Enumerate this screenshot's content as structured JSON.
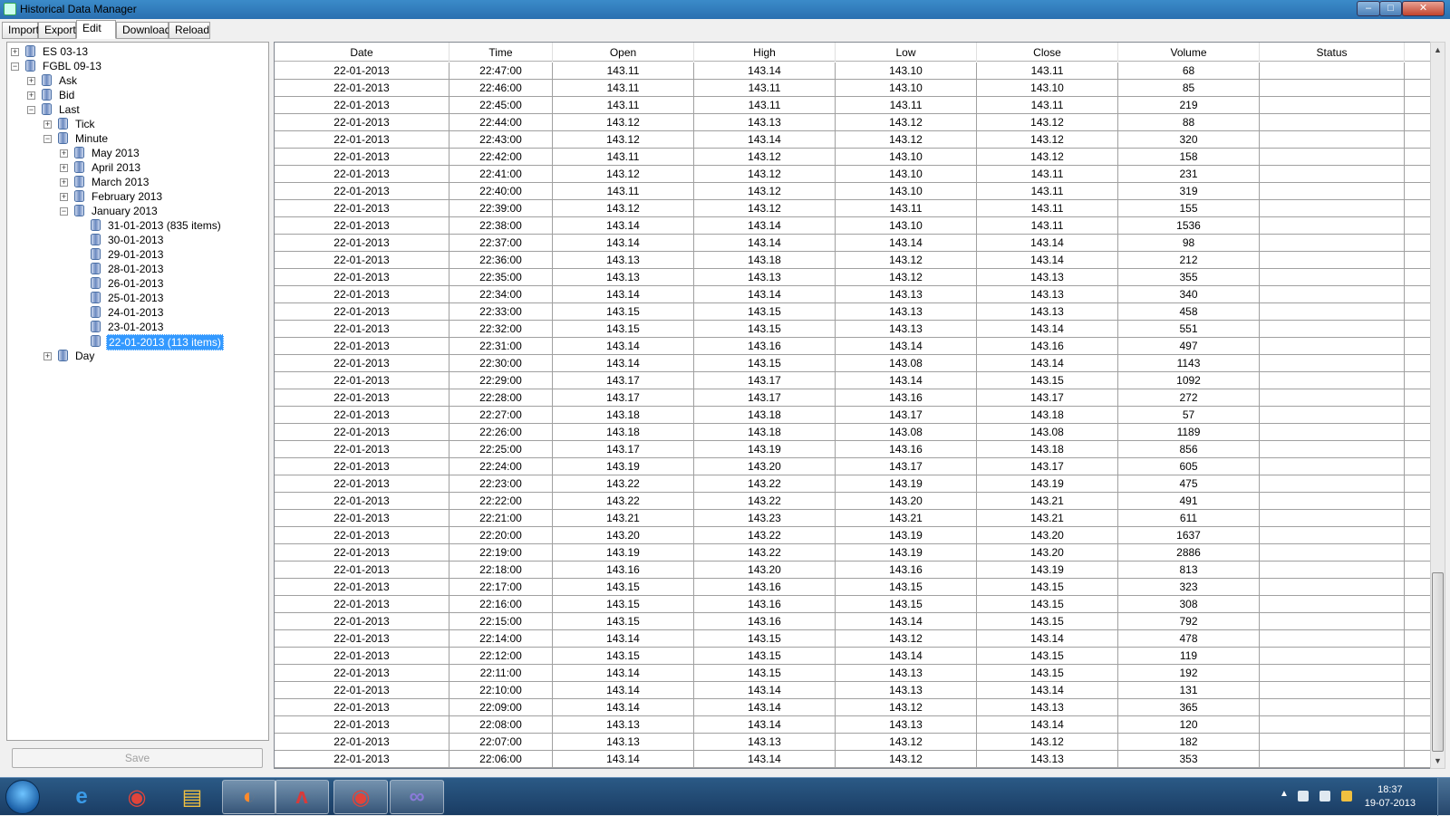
{
  "window": {
    "title": "Historical Data Manager",
    "minimize": "‒",
    "maximize": "□",
    "close": "✕"
  },
  "menu": {
    "tabs": [
      "Import",
      "Export",
      "Edit",
      "Download",
      "Reload"
    ],
    "active": "Edit"
  },
  "tree": {
    "nodes": [
      {
        "label": "ES 03-13",
        "level": 0,
        "expander": "+"
      },
      {
        "label": "FGBL 09-13",
        "level": 0,
        "expander": "−"
      },
      {
        "label": "Ask",
        "level": 1,
        "expander": "+"
      },
      {
        "label": "Bid",
        "level": 1,
        "expander": "+"
      },
      {
        "label": "Last",
        "level": 1,
        "expander": "−"
      },
      {
        "label": "Tick",
        "level": 2,
        "expander": "+"
      },
      {
        "label": "Minute",
        "level": 2,
        "expander": "−"
      },
      {
        "label": "May 2013",
        "level": 3,
        "expander": "+"
      },
      {
        "label": "April 2013",
        "level": 3,
        "expander": "+"
      },
      {
        "label": "March 2013",
        "level": 3,
        "expander": "+"
      },
      {
        "label": "February 2013",
        "level": 3,
        "expander": "+"
      },
      {
        "label": "January 2013",
        "level": 3,
        "expander": "−"
      },
      {
        "label": "31-01-2013 (835 items)",
        "level": 4,
        "expander": ""
      },
      {
        "label": "30-01-2013",
        "level": 4,
        "expander": ""
      },
      {
        "label": "29-01-2013",
        "level": 4,
        "expander": ""
      },
      {
        "label": "28-01-2013",
        "level": 4,
        "expander": ""
      },
      {
        "label": "26-01-2013",
        "level": 4,
        "expander": ""
      },
      {
        "label": "25-01-2013",
        "level": 4,
        "expander": ""
      },
      {
        "label": "24-01-2013",
        "level": 4,
        "expander": ""
      },
      {
        "label": "23-01-2013",
        "level": 4,
        "expander": ""
      },
      {
        "label": "22-01-2013 (113 items)",
        "level": 4,
        "expander": "",
        "selected": true
      },
      {
        "label": "Day",
        "level": 2,
        "expander": "+"
      }
    ],
    "save_label": "Save"
  },
  "grid": {
    "columns": [
      "Date",
      "Time",
      "Open",
      "High",
      "Low",
      "Close",
      "Volume",
      "Status"
    ],
    "rows": [
      [
        "22-01-2013",
        "22:47:00",
        "143.11",
        "143.14",
        "143.10",
        "143.11",
        "68",
        ""
      ],
      [
        "22-01-2013",
        "22:46:00",
        "143.11",
        "143.11",
        "143.10",
        "143.10",
        "85",
        ""
      ],
      [
        "22-01-2013",
        "22:45:00",
        "143.11",
        "143.11",
        "143.11",
        "143.11",
        "219",
        ""
      ],
      [
        "22-01-2013",
        "22:44:00",
        "143.12",
        "143.13",
        "143.12",
        "143.12",
        "88",
        ""
      ],
      [
        "22-01-2013",
        "22:43:00",
        "143.12",
        "143.14",
        "143.12",
        "143.12",
        "320",
        ""
      ],
      [
        "22-01-2013",
        "22:42:00",
        "143.11",
        "143.12",
        "143.10",
        "143.12",
        "158",
        ""
      ],
      [
        "22-01-2013",
        "22:41:00",
        "143.12",
        "143.12",
        "143.10",
        "143.11",
        "231",
        ""
      ],
      [
        "22-01-2013",
        "22:40:00",
        "143.11",
        "143.12",
        "143.10",
        "143.11",
        "319",
        ""
      ],
      [
        "22-01-2013",
        "22:39:00",
        "143.12",
        "143.12",
        "143.11",
        "143.11",
        "155",
        ""
      ],
      [
        "22-01-2013",
        "22:38:00",
        "143.14",
        "143.14",
        "143.10",
        "143.11",
        "1536",
        ""
      ],
      [
        "22-01-2013",
        "22:37:00",
        "143.14",
        "143.14",
        "143.14",
        "143.14",
        "98",
        ""
      ],
      [
        "22-01-2013",
        "22:36:00",
        "143.13",
        "143.18",
        "143.12",
        "143.14",
        "212",
        ""
      ],
      [
        "22-01-2013",
        "22:35:00",
        "143.13",
        "143.13",
        "143.12",
        "143.13",
        "355",
        ""
      ],
      [
        "22-01-2013",
        "22:34:00",
        "143.14",
        "143.14",
        "143.13",
        "143.13",
        "340",
        ""
      ],
      [
        "22-01-2013",
        "22:33:00",
        "143.15",
        "143.15",
        "143.13",
        "143.13",
        "458",
        ""
      ],
      [
        "22-01-2013",
        "22:32:00",
        "143.15",
        "143.15",
        "143.13",
        "143.14",
        "551",
        ""
      ],
      [
        "22-01-2013",
        "22:31:00",
        "143.14",
        "143.16",
        "143.14",
        "143.16",
        "497",
        ""
      ],
      [
        "22-01-2013",
        "22:30:00",
        "143.14",
        "143.15",
        "143.08",
        "143.14",
        "1143",
        ""
      ],
      [
        "22-01-2013",
        "22:29:00",
        "143.17",
        "143.17",
        "143.14",
        "143.15",
        "1092",
        ""
      ],
      [
        "22-01-2013",
        "22:28:00",
        "143.17",
        "143.17",
        "143.16",
        "143.17",
        "272",
        ""
      ],
      [
        "22-01-2013",
        "22:27:00",
        "143.18",
        "143.18",
        "143.17",
        "143.18",
        "57",
        ""
      ],
      [
        "22-01-2013",
        "22:26:00",
        "143.18",
        "143.18",
        "143.08",
        "143.08",
        "1189",
        ""
      ],
      [
        "22-01-2013",
        "22:25:00",
        "143.17",
        "143.19",
        "143.16",
        "143.18",
        "856",
        ""
      ],
      [
        "22-01-2013",
        "22:24:00",
        "143.19",
        "143.20",
        "143.17",
        "143.17",
        "605",
        ""
      ],
      [
        "22-01-2013",
        "22:23:00",
        "143.22",
        "143.22",
        "143.19",
        "143.19",
        "475",
        ""
      ],
      [
        "22-01-2013",
        "22:22:00",
        "143.22",
        "143.22",
        "143.20",
        "143.21",
        "491",
        ""
      ],
      [
        "22-01-2013",
        "22:21:00",
        "143.21",
        "143.23",
        "143.21",
        "143.21",
        "611",
        ""
      ],
      [
        "22-01-2013",
        "22:20:00",
        "143.20",
        "143.22",
        "143.19",
        "143.20",
        "1637",
        ""
      ],
      [
        "22-01-2013",
        "22:19:00",
        "143.19",
        "143.22",
        "143.19",
        "143.20",
        "2886",
        ""
      ],
      [
        "22-01-2013",
        "22:18:00",
        "143.16",
        "143.20",
        "143.16",
        "143.19",
        "813",
        ""
      ],
      [
        "22-01-2013",
        "22:17:00",
        "143.15",
        "143.16",
        "143.15",
        "143.15",
        "323",
        ""
      ],
      [
        "22-01-2013",
        "22:16:00",
        "143.15",
        "143.16",
        "143.15",
        "143.15",
        "308",
        ""
      ],
      [
        "22-01-2013",
        "22:15:00",
        "143.15",
        "143.16",
        "143.14",
        "143.15",
        "792",
        ""
      ],
      [
        "22-01-2013",
        "22:14:00",
        "143.14",
        "143.15",
        "143.12",
        "143.14",
        "478",
        ""
      ],
      [
        "22-01-2013",
        "22:12:00",
        "143.15",
        "143.15",
        "143.14",
        "143.15",
        "119",
        ""
      ],
      [
        "22-01-2013",
        "22:11:00",
        "143.14",
        "143.15",
        "143.13",
        "143.15",
        "192",
        ""
      ],
      [
        "22-01-2013",
        "22:10:00",
        "143.14",
        "143.14",
        "143.13",
        "143.14",
        "131",
        ""
      ],
      [
        "22-01-2013",
        "22:09:00",
        "143.14",
        "143.14",
        "143.12",
        "143.13",
        "365",
        ""
      ],
      [
        "22-01-2013",
        "22:08:00",
        "143.13",
        "143.14",
        "143.13",
        "143.14",
        "120",
        ""
      ],
      [
        "22-01-2013",
        "22:07:00",
        "143.13",
        "143.13",
        "143.12",
        "143.12",
        "182",
        ""
      ],
      [
        "22-01-2013",
        "22:06:00",
        "143.14",
        "143.14",
        "143.12",
        "143.13",
        "353",
        ""
      ]
    ]
  },
  "scrollbar": {
    "up": "▲",
    "down": "▼",
    "position_fraction": 0.75
  },
  "taskbar": {
    "items": [
      {
        "name": "start-button",
        "icon": "windows-orb-icon"
      },
      {
        "name": "internet-explorer",
        "icon": "ie-icon",
        "glyph": "e"
      },
      {
        "name": "chrome",
        "icon": "chrome-icon",
        "glyph": "◉"
      },
      {
        "name": "file-explorer",
        "icon": "folder-icon",
        "glyph": "▤"
      },
      {
        "name": "firefox",
        "icon": "firefox-icon",
        "glyph": "◐"
      },
      {
        "name": "trading-app",
        "icon": "app-icon",
        "glyph": "ʌ"
      },
      {
        "name": "chrome-2",
        "icon": "chrome-icon",
        "glyph": "◉"
      },
      {
        "name": "ninja-app",
        "icon": "infinity-icon",
        "glyph": "∞"
      }
    ],
    "tray_arrow": "▲",
    "clock_time": "18:37",
    "clock_date": "19-07-2013"
  },
  "colors": {
    "selection": "#3399ff",
    "taskbar": "#1f4a75",
    "titlebar": "#2f7ac0"
  }
}
